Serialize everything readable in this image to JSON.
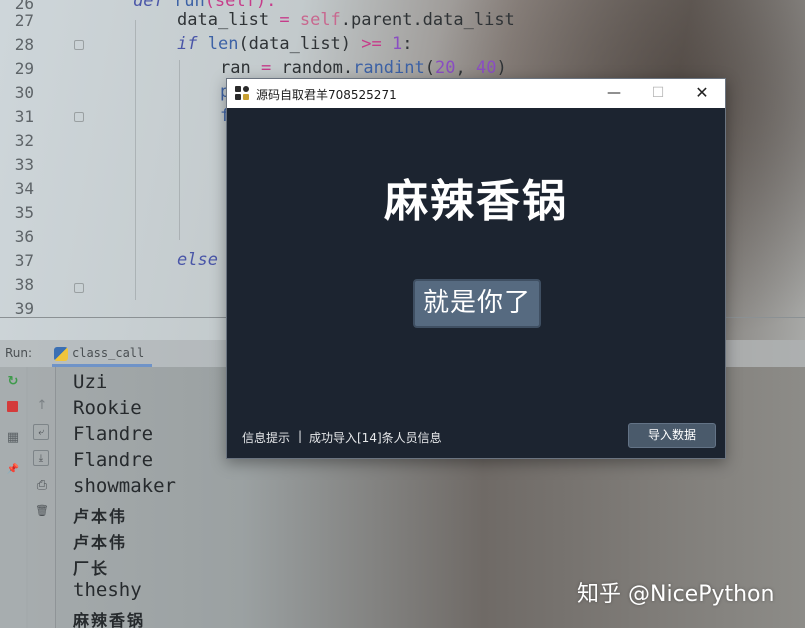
{
  "editor": {
    "line_numbers": [
      "26",
      "27",
      "28",
      "29",
      "30",
      "31",
      "32",
      "33",
      "34",
      "35",
      "36",
      "37",
      "38",
      "39"
    ],
    "code": {
      "l26_kw": "def",
      "l26_fn": "run",
      "l26_rest": "(self):",
      "l27_a": "data_list ",
      "l27_op": "=",
      "l27_self": " self",
      "l27_b": ".parent.data_list",
      "l28_kw": "if",
      "l28_a": " len",
      "l28_b": "(data_list) ",
      "l28_op": ">=",
      "l28_num": " 1",
      "l28_c": ":",
      "l29_a": "ran ",
      "l29_op": "=",
      "l29_b": " random.",
      "l29_fn": "randint",
      "l29_c": "(",
      "l29_n1": "20",
      "l29_d": ", ",
      "l29_n2": "40",
      "l29_e": ")",
      "l30_a": "p",
      "l31_a": "f",
      "l37_kw": "else"
    }
  },
  "run_panel": {
    "label": "Run:",
    "tab": "class_call",
    "tools": {
      "rerun": "↻",
      "layout": "▦",
      "pin": "📌",
      "up": "↑",
      "wrap": "⤶",
      "scroll": "⤓",
      "print": "⎙",
      "trash": "🗑"
    },
    "output": [
      "Uzi",
      "Rookie",
      "Flandre",
      "Flandre",
      "showmaker",
      "卢本伟",
      "卢本伟",
      "厂长",
      "theshy",
      "麻辣香锅"
    ]
  },
  "app_window": {
    "title": "源码自取君羊708525271",
    "controls": {
      "minimize": "—",
      "maximize": "☐",
      "close": "✕"
    },
    "result_name": "麻辣香锅",
    "pick_button": "就是你了",
    "status_label": "信息提示",
    "status_separator": "|",
    "status_text": "成功导入[14]条人员信息",
    "import_button": "导入数据"
  },
  "watermark": "知乎 @NicePython"
}
